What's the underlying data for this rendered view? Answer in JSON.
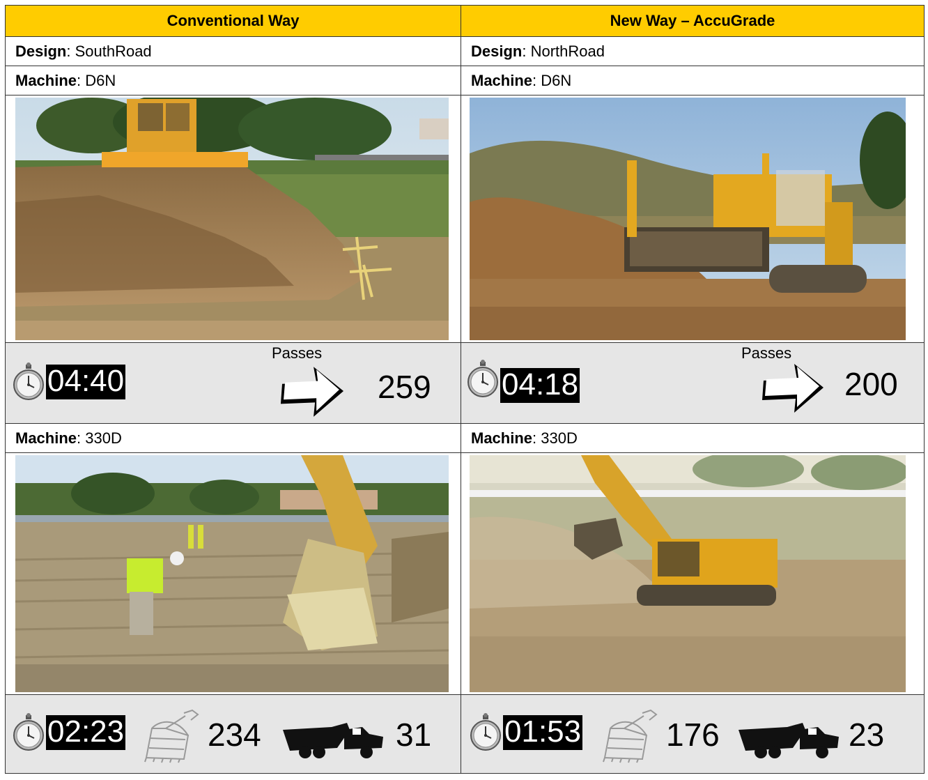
{
  "header": {
    "left": "Conventional Way",
    "right": "New Way – AccuGrade"
  },
  "left": {
    "design_label": "Design",
    "design_value": ": SouthRoad",
    "machine1_label": "Machine",
    "machine1_value": ": D6N",
    "dozer_time": "04:40",
    "passes_label": "Passes",
    "passes": "259",
    "machine2_label": "Machine",
    "machine2_value": ": 330D",
    "exc_time": "02:23",
    "buckets": "234",
    "trucks": "31"
  },
  "right": {
    "design_label": "Design",
    "design_value": ": NorthRoad",
    "machine1_label": "Machine",
    "machine1_value": ": D6N",
    "dozer_time": "04:18",
    "passes_label": "Passes",
    "passes": "200",
    "machine2_label": "Machine",
    "machine2_value": ": 330D",
    "exc_time": "01:53",
    "buckets": "176",
    "trucks": "23"
  },
  "colors": {
    "header_bg": "#ffcc00",
    "stat_bg": "#e6e6e6",
    "timer_bg": "#000000"
  },
  "icons": [
    "stopwatch-icon",
    "arrow-right-icon",
    "bucket-icon",
    "dump-truck-icon"
  ]
}
